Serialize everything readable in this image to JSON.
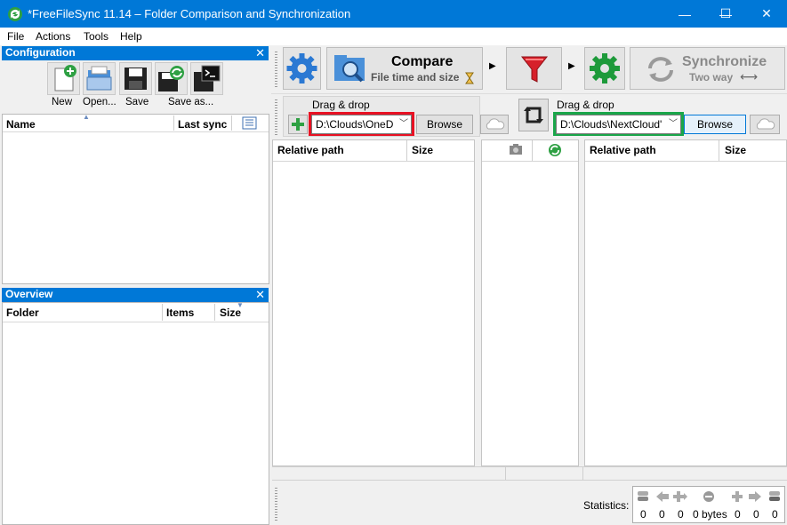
{
  "window": {
    "title": "*FreeFileSync 11.14 – Folder Comparison and Synchronization",
    "minimize_glyph": "—",
    "maximize_glyph": "☐",
    "close_glyph": "✕"
  },
  "menu": [
    "File",
    "Actions",
    "Tools",
    "Help"
  ],
  "config_pane": {
    "title": "Configuration",
    "close_glyph": "✕",
    "buttons": [
      "New",
      "Open...",
      "Save",
      "Save as..."
    ],
    "columns": {
      "name": "Name",
      "last_sync": "Last sync"
    }
  },
  "overview_pane": {
    "title": "Overview",
    "close_glyph": "✕",
    "columns": {
      "folder": "Folder",
      "items": "Items",
      "size": "Size"
    }
  },
  "toolbar": {
    "compare_label": "Compare",
    "compare_sub": "File time and size",
    "sync_label": "Synchronize",
    "sync_sub": "Two way"
  },
  "folders": {
    "left_drag": "Drag & drop",
    "left_path": "D:\\Clouds\\OneD",
    "left_browse": "Browse",
    "right_drag": "Drag & drop",
    "right_path": "D:\\Clouds\\NextCloud'",
    "right_browse": "Browse",
    "highlight_left": "#e81123",
    "highlight_right": "#1aa64a"
  },
  "grid": {
    "left": {
      "rel_path": "Relative path",
      "size": "Size"
    },
    "right": {
      "rel_path": "Relative path",
      "size": "Size"
    }
  },
  "statistics": {
    "label": "Statistics:",
    "values": [
      "0",
      "0",
      "0",
      "0 bytes",
      "0",
      "0",
      "0"
    ]
  }
}
